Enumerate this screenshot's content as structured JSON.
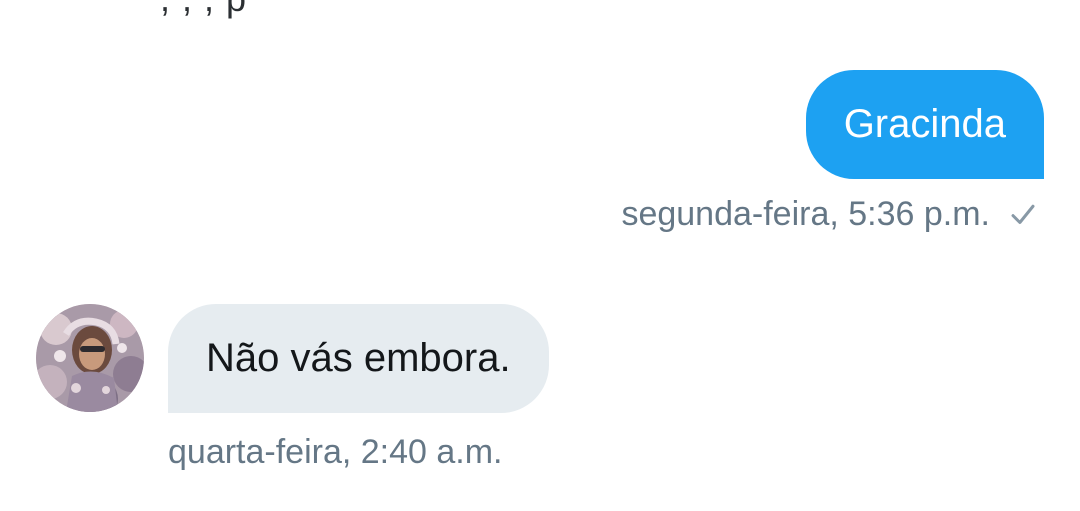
{
  "conversation": {
    "previous_message_fragment": "  ,   ,   ,   p",
    "outgoing": {
      "text": "Gracinda",
      "timestamp": "segunda-feira, 5:36 p.m.",
      "status_icon": "check-icon"
    },
    "incoming": {
      "avatar_icon": "avatar",
      "text": "Não vás embora.",
      "timestamp": "quarta-feira, 2:40 a.m."
    }
  },
  "colors": {
    "outgoing_bubble": "#1da1f2",
    "incoming_bubble": "#e6ecf0",
    "meta_text": "#657786"
  }
}
